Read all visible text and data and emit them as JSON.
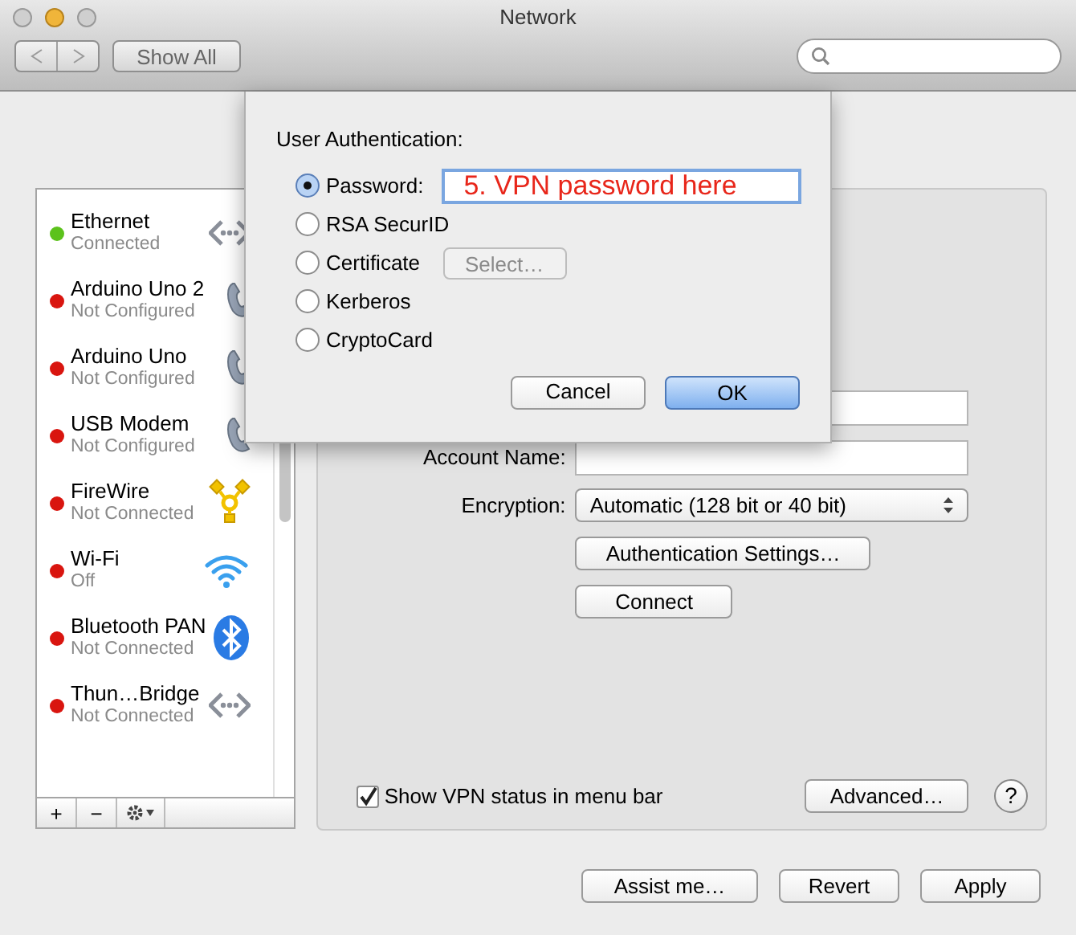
{
  "window": {
    "title": "Network"
  },
  "toolbar": {
    "show_all": "Show All"
  },
  "services": [
    {
      "name": "Ethernet",
      "status": "Connected",
      "color": "#5cc21c",
      "kind": "ethernet",
      "selected": false
    },
    {
      "name": "Arduino Uno 2",
      "status": "Not Configured",
      "color": "#d9150f",
      "kind": "phone",
      "selected": false
    },
    {
      "name": "Arduino Uno",
      "status": "Not Configured",
      "color": "#d9150f",
      "kind": "phone",
      "selected": false
    },
    {
      "name": "USB Modem",
      "status": "Not Configured",
      "color": "#d9150f",
      "kind": "phone",
      "selected": false
    },
    {
      "name": "FireWire",
      "status": "Not Connected",
      "color": "#d9150f",
      "kind": "firewire",
      "selected": false
    },
    {
      "name": "Wi-Fi",
      "status": "Off",
      "color": "#d9150f",
      "kind": "wifi",
      "selected": false
    },
    {
      "name": "Bluetooth PAN",
      "status": "Not Connected",
      "color": "#d9150f",
      "kind": "bluetooth",
      "selected": false
    },
    {
      "name": "Thun…Bridge",
      "status": "Not Connected",
      "color": "#d9150f",
      "kind": "bridge",
      "selected": false
    }
  ],
  "list_buttons": [
    "+",
    "−"
  ],
  "form": {
    "account_label": "Account Name:",
    "encryption_label": "Encryption:",
    "encryption_value": "Automatic (128 bit or 40 bit)",
    "auth_settings": "Authentication Settings…",
    "connect": "Connect"
  },
  "show_status": {
    "label": "Show VPN status in menu bar",
    "checked": true
  },
  "advanced": "Advanced…",
  "help": "?",
  "footer": [
    "Assist me…",
    "Revert",
    "Apply"
  ],
  "sheet": {
    "title": "User Authentication:",
    "options": [
      {
        "label": "Password:",
        "selected": true,
        "kind": "field",
        "value": "5. VPN password here"
      },
      {
        "label": "RSA SecurID",
        "selected": false,
        "kind": "plain"
      },
      {
        "label": "Certificate",
        "selected": false,
        "kind": "button",
        "button": "Select…",
        "disabled": true
      },
      {
        "label": "Kerberos",
        "selected": false,
        "kind": "plain"
      },
      {
        "label": "CryptoCard",
        "selected": false,
        "kind": "plain"
      }
    ],
    "cancel": "Cancel",
    "ok": "OK"
  }
}
